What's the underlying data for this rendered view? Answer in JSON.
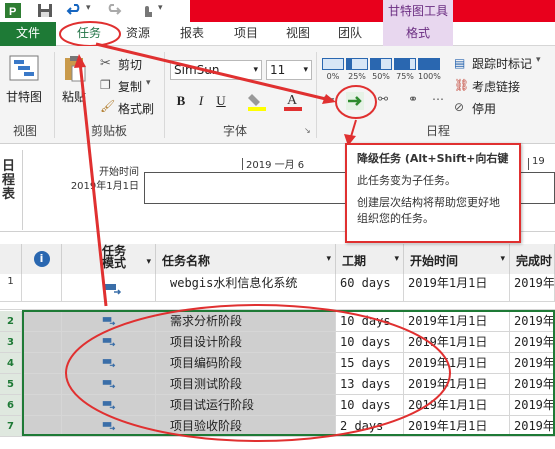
{
  "titlebar": {
    "context_tab": "甘特图工具"
  },
  "tabs": [
    "文件",
    "任务",
    "资源",
    "报表",
    "项目",
    "视图",
    "团队",
    "格式"
  ],
  "ribbon": {
    "gantt_label": "甘特图",
    "paste_label": "粘贴",
    "cut_label": "剪切",
    "copy_label": "复制",
    "format_painter_label": "格式刷",
    "font_name": "SimSun",
    "font_size": "11",
    "bold": "B",
    "italic": "I",
    "underline": "U",
    "schedule_labels": [
      "0%",
      "25%",
      "50%",
      "75%",
      "100%"
    ],
    "respect_links_label": "跟踪时标记",
    "consider_links_label": "考虑链接",
    "inactivate_label": "停用",
    "groups": {
      "view": "视图",
      "clipboard": "剪贴板",
      "font": "字体",
      "schedule": "日程"
    }
  },
  "timeline": {
    "side_label": "日程表",
    "start_label": "开始时间",
    "start_date": "2019年1月1日",
    "date_mark": "2019 一月 6",
    "date_mark_2": "19"
  },
  "tooltip": {
    "title": "降级任务 (Alt+Shift+向右键",
    "line1": "此任务变为子任务。",
    "line2": "创建层次结构将帮助您更好地组织您的任务。"
  },
  "grid": {
    "columns": {
      "info": "ⓘ",
      "mode": "任务模式",
      "name": "任务名称",
      "duration": "工期",
      "start": "开始时间",
      "finish": "完成时"
    },
    "rows": [
      {
        "id": "1",
        "name": "webgis水利信息化系统",
        "duration": "60 days",
        "start": "2019年1月1日",
        "finish": "2019年",
        "selected": false
      },
      {
        "id": "2",
        "name": "需求分析阶段",
        "duration": "10 days",
        "start": "2019年1月1日",
        "finish": "2019年",
        "selected": true
      },
      {
        "id": "3",
        "name": "项目设计阶段",
        "duration": "10 days",
        "start": "2019年1月1日",
        "finish": "2019年",
        "selected": true
      },
      {
        "id": "4",
        "name": "项目编码阶段",
        "duration": "15 days",
        "start": "2019年1月1日",
        "finish": "2019年",
        "selected": true
      },
      {
        "id": "5",
        "name": "项目测试阶段",
        "duration": "13 days",
        "start": "2019年1月1日",
        "finish": "2019年",
        "selected": true
      },
      {
        "id": "6",
        "name": "项目试运行阶段",
        "duration": "10 days",
        "start": "2019年1月1日",
        "finish": "2019年",
        "selected": true
      },
      {
        "id": "7",
        "name": "项目验收阶段",
        "duration": "2 days",
        "start": "2019年1月1日",
        "finish": "2019年",
        "selected": true
      }
    ]
  },
  "colors": {
    "file_tab": "#1e7a36",
    "accent_red": "#e03030",
    "context": "#e8d7ef"
  }
}
